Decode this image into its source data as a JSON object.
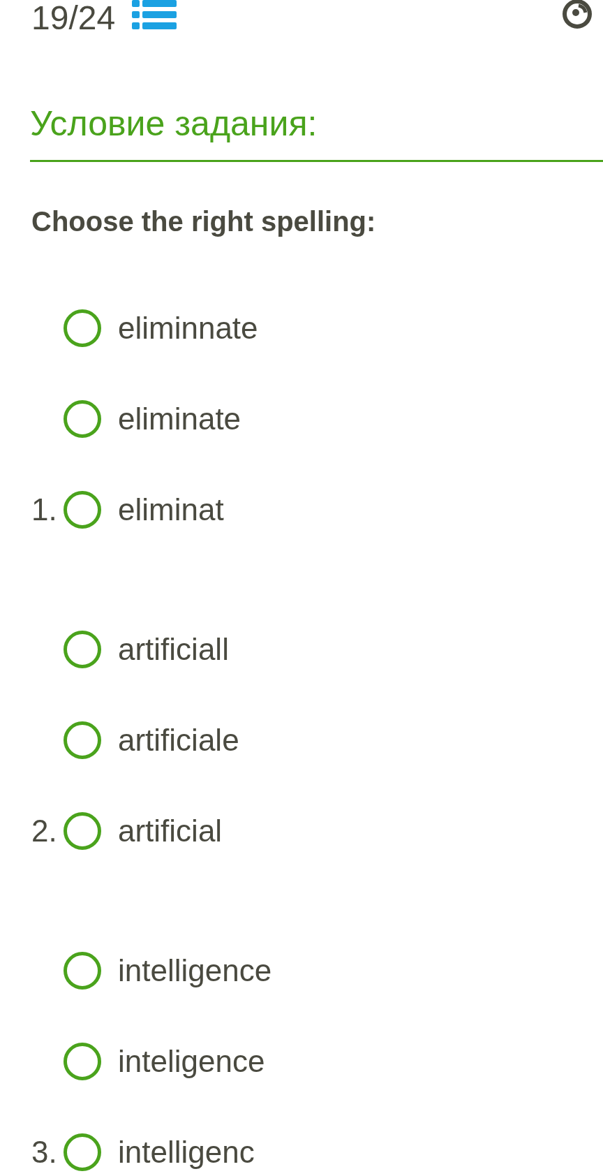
{
  "header": {
    "progress": "19/24"
  },
  "task_title": "Условие задания:",
  "prompt": "Choose the right spelling:",
  "questions": [
    {
      "number": "1.",
      "options": [
        {
          "label": "eliminnate",
          "selected": false
        },
        {
          "label": "eliminate",
          "selected": false
        },
        {
          "label": "eliminat",
          "selected": false
        }
      ]
    },
    {
      "number": "2.",
      "options": [
        {
          "label": "artificiall",
          "selected": false
        },
        {
          "label": "artificiale",
          "selected": false
        },
        {
          "label": "artificial",
          "selected": false
        }
      ]
    },
    {
      "number": "3.",
      "options": [
        {
          "label": "intelligence",
          "selected": false
        },
        {
          "label": "inteligence",
          "selected": false
        },
        {
          "label": "intelligenc",
          "selected": false
        }
      ]
    }
  ]
}
